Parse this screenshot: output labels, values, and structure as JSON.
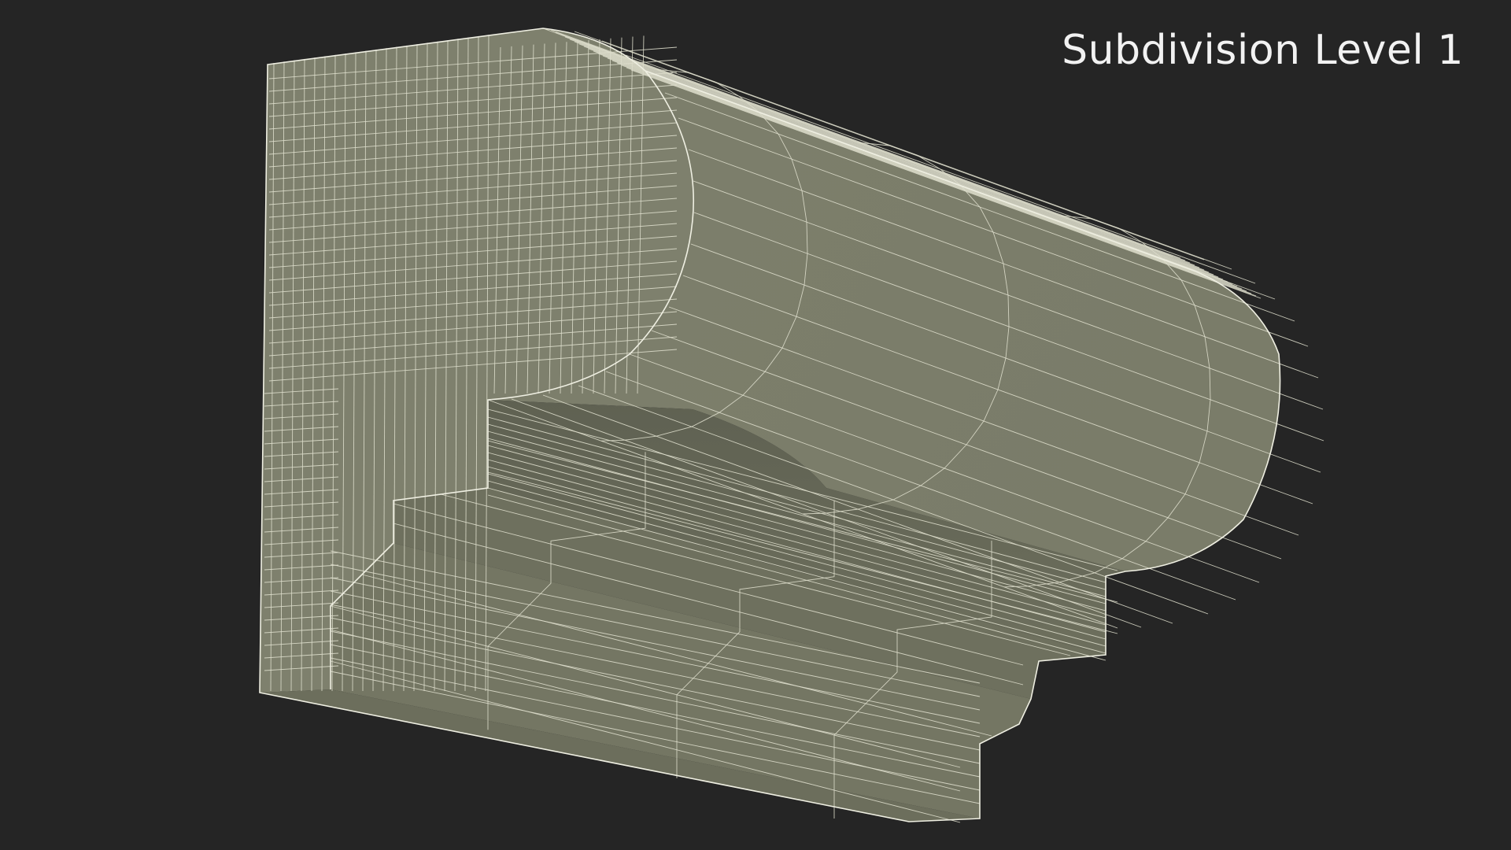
{
  "viewport": {
    "label": "Subdivision Level 1"
  },
  "model": {
    "icon": "wireframe-molding-mesh",
    "mesh_color": "#7a7c68",
    "wire_color": "#ddddcb",
    "background_color": "#252525"
  }
}
